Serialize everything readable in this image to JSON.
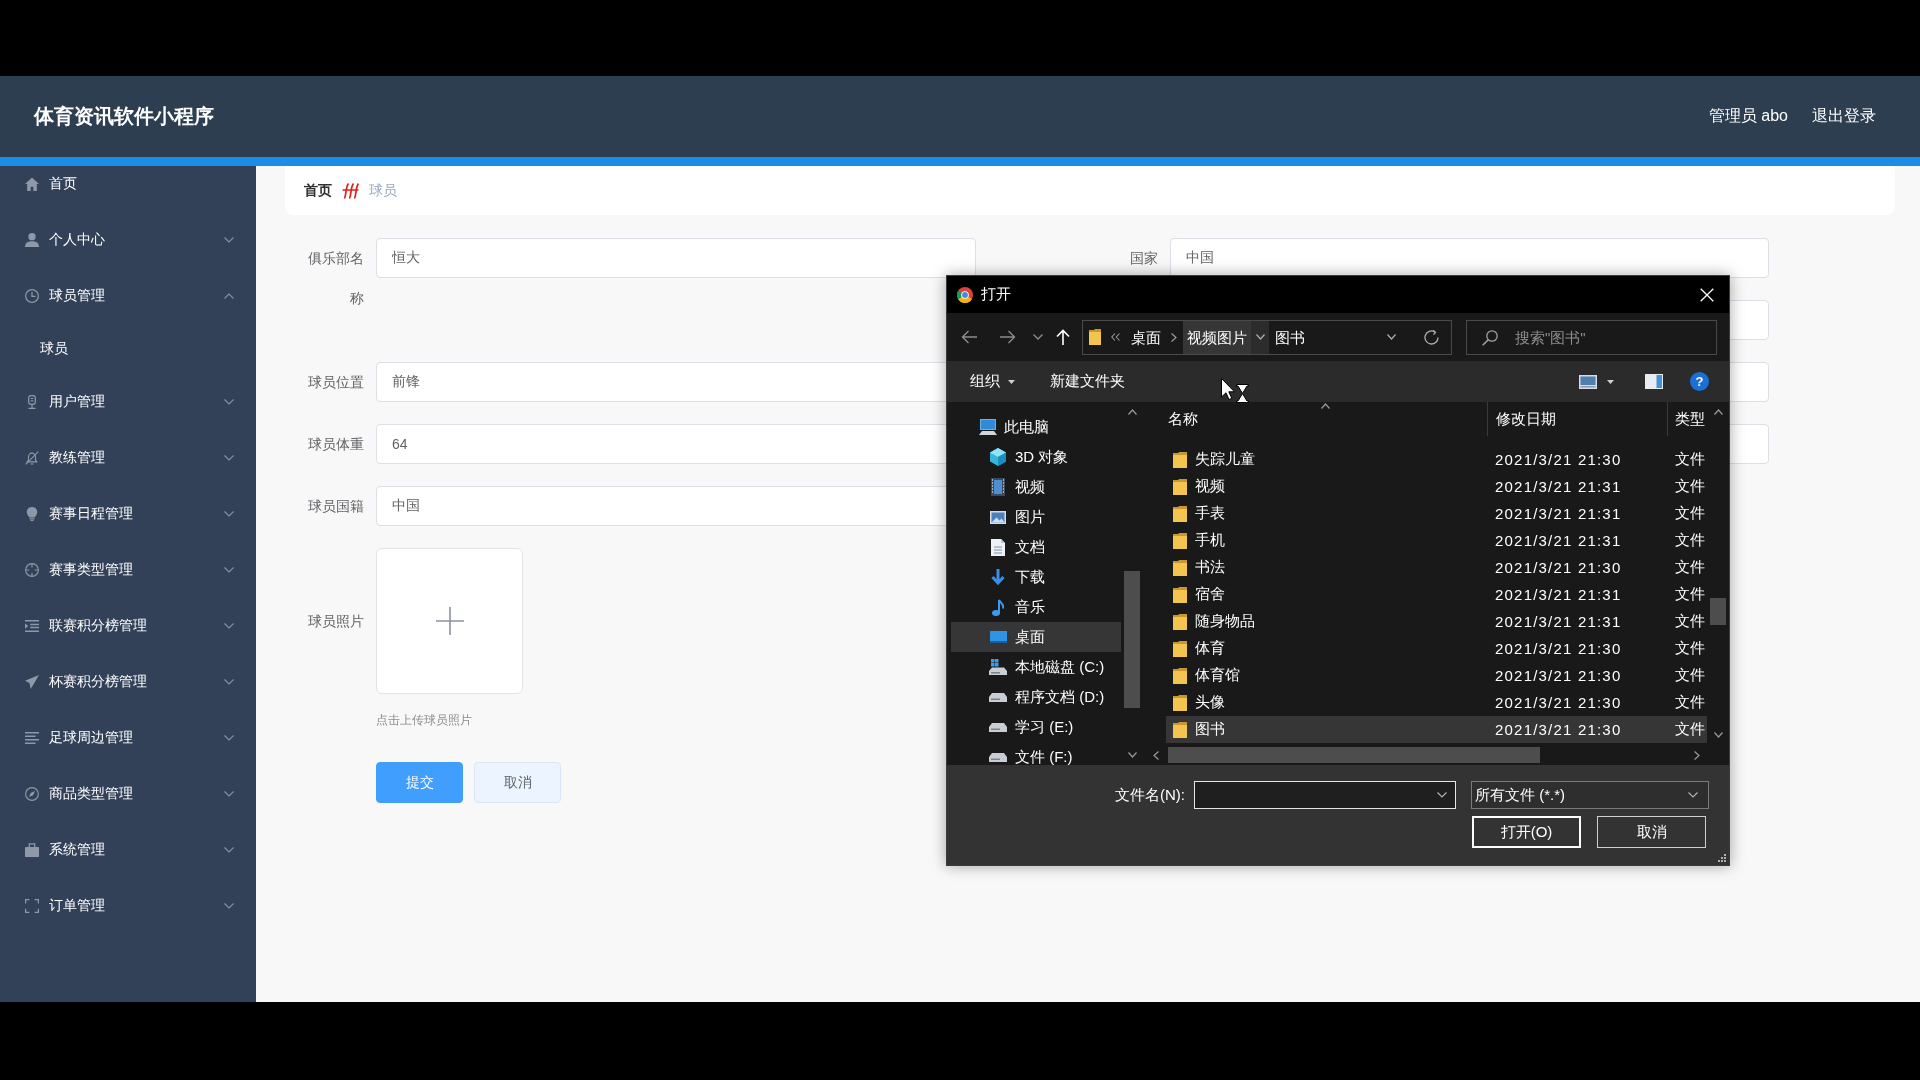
{
  "header": {
    "title": "体育资讯软件小程序",
    "user": "管理员 abo",
    "logout": "退出登录"
  },
  "sidebar": {
    "items": [
      {
        "label": "首页",
        "kind": "link"
      },
      {
        "label": "个人中心",
        "kind": "submenu",
        "expanded": false
      },
      {
        "label": "球员管理",
        "kind": "submenu",
        "expanded": true,
        "children": [
          {
            "label": "球员"
          }
        ]
      },
      {
        "label": "用户管理",
        "kind": "submenu",
        "expanded": false
      },
      {
        "label": "教练管理",
        "kind": "submenu",
        "expanded": false
      },
      {
        "label": "赛事日程管理",
        "kind": "submenu",
        "expanded": false
      },
      {
        "label": "赛事类型管理",
        "kind": "submenu",
        "expanded": false
      },
      {
        "label": "联赛积分榜管理",
        "kind": "submenu",
        "expanded": false
      },
      {
        "label": "杯赛积分榜管理",
        "kind": "submenu",
        "expanded": false
      },
      {
        "label": "足球周边管理",
        "kind": "submenu",
        "expanded": false
      },
      {
        "label": "商品类型管理",
        "kind": "submenu",
        "expanded": false
      },
      {
        "label": "系统管理",
        "kind": "submenu",
        "expanded": false
      },
      {
        "label": "订单管理",
        "kind": "submenu",
        "expanded": false
      }
    ]
  },
  "breadcrumb": [
    {
      "label": "首页",
      "current": false
    },
    {
      "label": "球员",
      "current": true
    }
  ],
  "form": {
    "left_fields": [
      {
        "label": "俱乐部名称",
        "value": "恒大"
      },
      {
        "label": "球员位置",
        "value": "前锋"
      },
      {
        "label": "球员体重",
        "value": "64"
      },
      {
        "label": "球员国籍",
        "value": "中国"
      }
    ],
    "upload": {
      "label": "球员照片",
      "hint": "点击上传球员照片"
    },
    "right_fields": [
      {
        "kind": "text",
        "label": "国家",
        "value": "中国"
      },
      {
        "kind": "text"
      },
      {
        "kind": "text"
      },
      {
        "kind": "text"
      }
    ],
    "buttons": [
      {
        "label": "提交",
        "kind": "primary"
      },
      {
        "label": "取消",
        "kind": "plain"
      }
    ]
  },
  "file_dialog": {
    "title": "打开",
    "address": [
      {
        "label": "桌面",
        "hovered": false
      },
      {
        "label": "视频图片",
        "hovered": true
      },
      {
        "label": "图书",
        "hovered": false
      }
    ],
    "search": {
      "placeholder": "搜索\"图书\""
    },
    "toolbar": {
      "organize": "组织",
      "new_folder": "新建文件夹",
      "help": "?"
    },
    "nav": [
      {
        "label": "此电脑",
        "selected": false,
        "children": [
          {
            "label": "3D 对象",
            "selected": false
          },
          {
            "label": "视频",
            "selected": false
          },
          {
            "label": "图片",
            "selected": false
          },
          {
            "label": "文档",
            "selected": false
          },
          {
            "label": "下载",
            "selected": false
          },
          {
            "label": "音乐",
            "selected": false
          },
          {
            "label": "桌面",
            "selected": true
          },
          {
            "label": "本地磁盘 (C:)",
            "selected": false
          },
          {
            "label": "程序文档 (D:)",
            "selected": false
          },
          {
            "label": "学习 (E:)",
            "selected": false
          },
          {
            "label": "文件 (F:)",
            "selected": false
          }
        ]
      }
    ],
    "columns": [
      "名称",
      "修改日期",
      "类型"
    ],
    "rows": [
      {
        "name": "失踪儿童",
        "date": "2021/3/21 21:30",
        "type": "文件",
        "selected": false
      },
      {
        "name": "视频",
        "date": "2021/3/21 21:31",
        "type": "文件",
        "selected": false
      },
      {
        "name": "手表",
        "date": "2021/3/21 21:31",
        "type": "文件",
        "selected": false
      },
      {
        "name": "手机",
        "date": "2021/3/21 21:31",
        "type": "文件",
        "selected": false
      },
      {
        "name": "书法",
        "date": "2021/3/21 21:30",
        "type": "文件",
        "selected": false
      },
      {
        "name": "宿舍",
        "date": "2021/3/21 21:31",
        "type": "文件",
        "selected": false
      },
      {
        "name": "随身物品",
        "date": "2021/3/21 21:31",
        "type": "文件",
        "selected": false
      },
      {
        "name": "体育",
        "date": "2021/3/21 21:30",
        "type": "文件",
        "selected": false
      },
      {
        "name": "体育馆",
        "date": "2021/3/21 21:30",
        "type": "文件",
        "selected": false
      },
      {
        "name": "头像",
        "date": "2021/3/21 21:30",
        "type": "文件",
        "selected": false
      },
      {
        "name": "图书",
        "date": "2021/3/21 21:30",
        "type": "文件",
        "selected": true
      }
    ],
    "filename": {
      "label": "文件名(N):"
    },
    "file_type": {
      "value": "所有文件 (*.*)"
    },
    "buttons": [
      {
        "label": "打开(O)",
        "default": true
      },
      {
        "label": "取消",
        "default": false
      }
    ]
  }
}
